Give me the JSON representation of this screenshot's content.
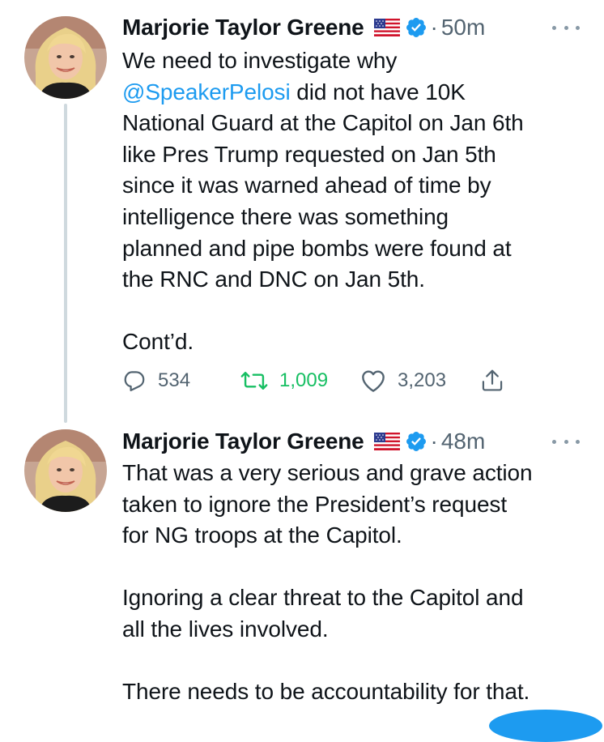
{
  "colors": {
    "link": "#1d9bf0",
    "verified": "#1d9bf0",
    "retweet_active": "#17bf63",
    "muted": "#536471",
    "thread_line": "#cfd9de"
  },
  "tweets": [
    {
      "author": "Marjorie Taylor Greene",
      "flag_icon": "us-flag-icon",
      "verified_icon": "verified-badge-icon",
      "separator": "·",
      "time": "50m",
      "lines": [
        "We need to investigate why",
        [
          "@SpeakerPelosi",
          " did not have 10K"
        ],
        "National Guard at the Capitol on Jan 6th",
        "like Pres Trump requested on Jan 5th",
        "since it was warned ahead of time by",
        "intelligence there was something",
        "planned and pipe bombs were found at",
        "the RNC and DNC on Jan 5th.",
        "",
        "Cont’d."
      ],
      "mention": "@SpeakerPelosi",
      "mention_rest": " did not have 10K",
      "actions": {
        "reply_icon": "reply-icon",
        "reply_count": "534",
        "retweet_icon": "retweet-icon",
        "retweet_count": "1,009",
        "like_icon": "heart-icon",
        "like_count": "3,203",
        "share_icon": "share-icon"
      }
    },
    {
      "author": "Marjorie Taylor Greene",
      "flag_icon": "us-flag-icon",
      "verified_icon": "verified-badge-icon",
      "separator": "·",
      "time": "48m",
      "lines": [
        "That was a very serious and grave action",
        "taken to ignore the President’s request",
        "for NG troops at the Capitol.",
        "",
        "Ignoring a clear threat to the Capitol and",
        "all the lives involved.",
        "",
        "There needs to be accountability for that."
      ]
    }
  ]
}
